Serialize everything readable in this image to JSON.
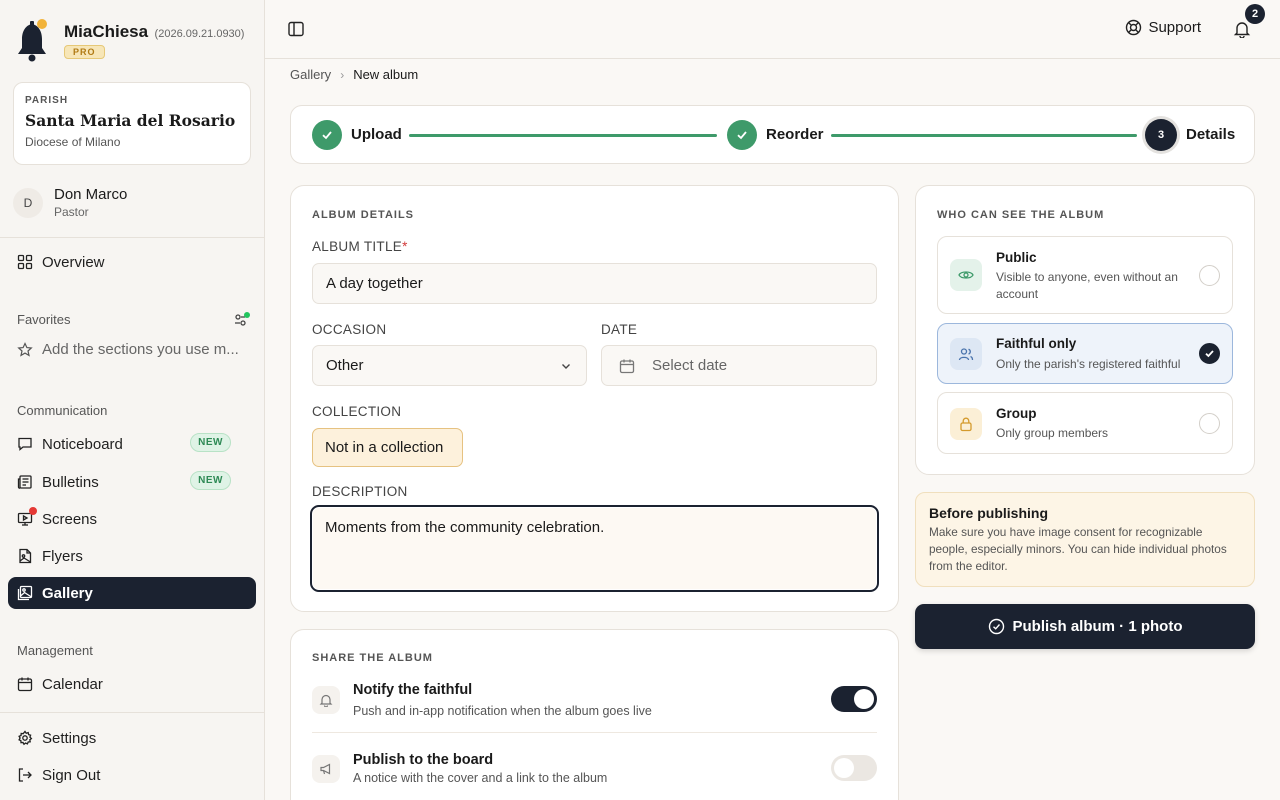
{
  "brand": {
    "name": "MiaChiesa",
    "version": "(2026.09.21.0930)",
    "badge": "PRO"
  },
  "parish": {
    "kicker": "PARISH",
    "name": "Santa Maria del Rosario",
    "diocese": "Diocese of Milano"
  },
  "user": {
    "initial": "D",
    "name": "Don Marco",
    "role": "Pastor"
  },
  "nav": {
    "overview": "Overview",
    "favorites_label": "Favorites",
    "favorites_hint": "Add the sections you use m...",
    "communication_label": "Communication",
    "noticeboard": "Noticeboard",
    "bulletins": "Bulletins",
    "screens": "Screens",
    "flyers": "Flyers",
    "gallery": "Gallery",
    "new_badge": "NEW",
    "management_label": "Management",
    "calendar": "Calendar",
    "settings": "Settings",
    "sign_out": "Sign Out"
  },
  "topbar": {
    "support": "Support",
    "notifications_count": "2"
  },
  "breadcrumb": {
    "parent": "Gallery",
    "separator": "›",
    "current": "New album"
  },
  "stepper": {
    "step1": "Upload",
    "step2": "Reorder",
    "step3_number": "3",
    "step3": "Details"
  },
  "album_details": {
    "section_title": "ALBUM DETAILS",
    "title_label": "ALBUM TITLE",
    "required_mark": "*",
    "title_value": "A day together",
    "occasion_label": "OCCASION",
    "occasion_value": "Other",
    "date_label": "DATE",
    "date_placeholder": "Select date",
    "collection_label": "COLLECTION",
    "collection_value": "Not in a collection",
    "description_label": "DESCRIPTION",
    "description_value": "Moments from the community celebration."
  },
  "share": {
    "section_title": "SHARE THE ALBUM",
    "notify_title": "Notify the faithful",
    "notify_desc": "Push and in-app notification when the album goes live",
    "notify_on": true,
    "board_title": "Publish to the board",
    "board_desc": "A notice with the cover and a link to the album",
    "board_on": false
  },
  "visibility": {
    "section_title": "WHO CAN SEE THE ALBUM",
    "options": [
      {
        "title": "Public",
        "desc": "Visible to anyone, even without an account",
        "selected": false
      },
      {
        "title": "Faithful only",
        "desc": "Only the parish's registered faithful",
        "selected": true
      },
      {
        "title": "Group",
        "desc": "Only group members",
        "selected": false
      }
    ]
  },
  "notice": {
    "title": "Before publishing",
    "body": "Make sure you have image consent for recognizable people, especially minors. You can hide individual photos from the editor."
  },
  "publish_button": "Publish album · 1 photo",
  "colors": {
    "accent_dark": "#1b2230",
    "success": "#3e9a6a",
    "warning_bg": "#fdf5e6",
    "brand_gold": "#f2b33a"
  }
}
